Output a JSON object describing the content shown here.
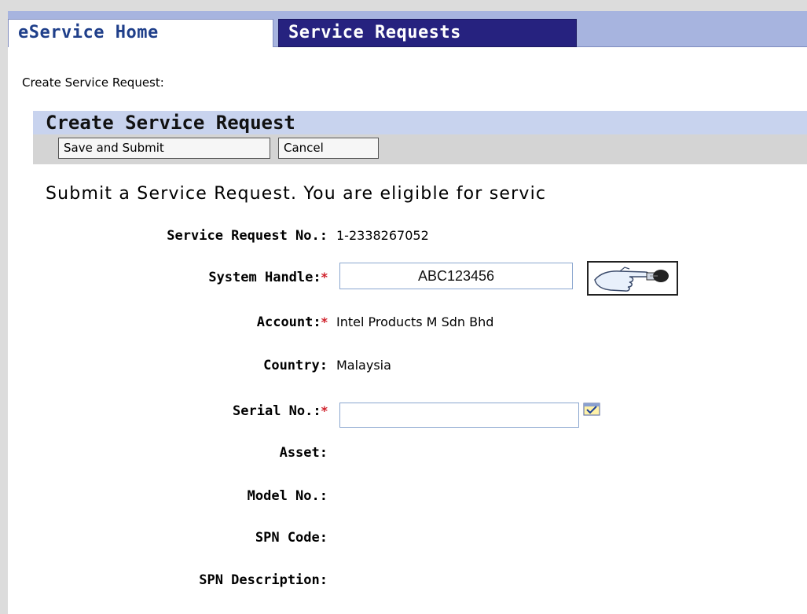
{
  "tabs": {
    "home": "eService Home",
    "service_requests": "Service Requests"
  },
  "breadcrumb": "Create Service Request:",
  "panel": {
    "title": "Create Service Request",
    "save_submit_label": "Save and Submit",
    "cancel_label": "Cancel"
  },
  "intro_text": "Submit a Service Request. You are eligible for servic",
  "form": {
    "sr_no": {
      "label": "Service Request No.",
      "value": "1-2338267052"
    },
    "system_handle": {
      "label": "System Handle:",
      "value": "ABC123456",
      "required_mark": "*"
    },
    "account": {
      "label": "Account:",
      "value": "Intel Products M Sdn Bhd",
      "required_mark": "*"
    },
    "country": {
      "label": "Country",
      "value": "Malaysia"
    },
    "serial_no": {
      "label": "Serial No.:",
      "value": "",
      "required_mark": "*"
    },
    "asset": {
      "label": "Asset:"
    },
    "model_no": {
      "label": "Model No.:"
    },
    "spn_code": {
      "label": "SPN Code:"
    },
    "spn_description": {
      "label": "SPN Description:"
    }
  },
  "icons": {
    "hint": "pointing-hand-lightbulb-icon",
    "picker": "picker-icon"
  },
  "colors": {
    "tabbar_bg": "#a7b4df",
    "active_tab_bg": "#26227f",
    "panel_header_bg": "#c8d3ee",
    "toolbar_bg": "#d4d4d4",
    "required": "#d0202a"
  }
}
